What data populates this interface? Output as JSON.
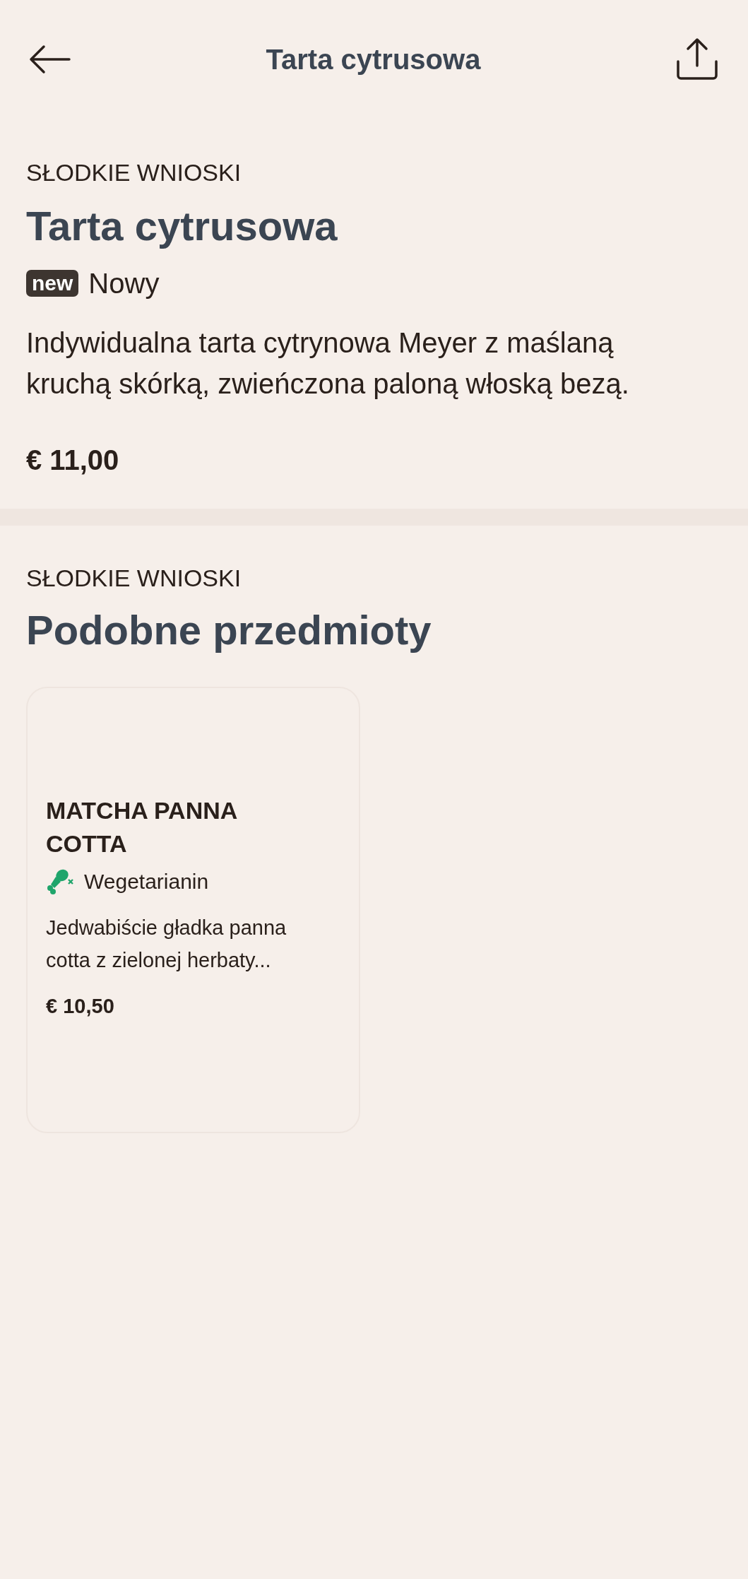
{
  "header": {
    "title": "Tarta cytrusowa"
  },
  "item": {
    "category": "SŁODKIE WNIOSKI",
    "name": "Tarta cytrusowa",
    "badge": "new",
    "badge_label": "Nowy",
    "description": "Indywidualna tarta cytrynowa Meyer z maślaną kruchą skórką, zwieńczona paloną włoską bezą.",
    "price": "€ 11,00"
  },
  "similar": {
    "category": "SŁODKIE WNIOSKI",
    "title": "Podobne przedmioty",
    "items": [
      {
        "name": "MATCHA PANNA COTTA",
        "tags": [
          {
            "kind": "no-meat",
            "label": "Wegetarianin",
            "color": "#1fa56b"
          }
        ],
        "description": "Jedwabiście gładka panna cotta z zielonej herbaty...",
        "price": "€ 10,50"
      }
    ]
  }
}
